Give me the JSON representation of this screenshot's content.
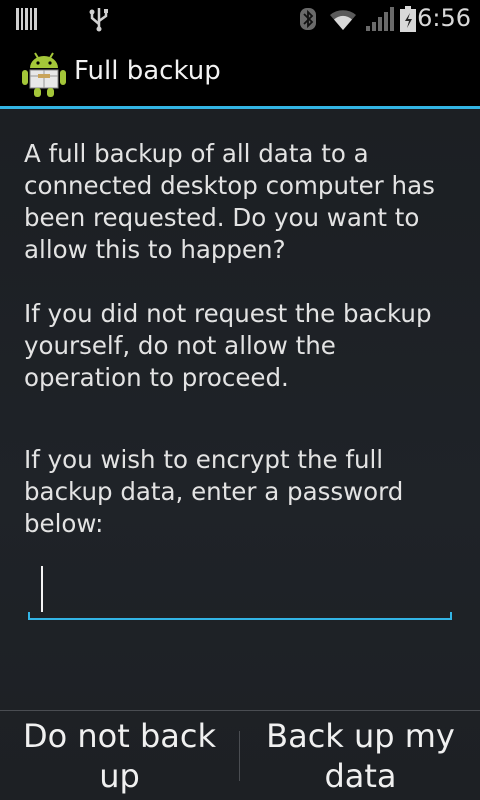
{
  "status_bar": {
    "time": "6:56",
    "icons": [
      "barcode-notification-icon",
      "usb-icon",
      "bluetooth-icon",
      "wifi-icon",
      "signal-icon",
      "battery-icon"
    ]
  },
  "title_bar": {
    "icon": "android-robot-icon",
    "title": "Full backup"
  },
  "message": {
    "paragraph1": "A full backup of all data to a connected desktop computer has been requested. Do you want to allow this to happen?",
    "paragraph2": "If you did not request the backup yourself, do not allow the operation to proceed.",
    "paragraph3": "If you wish to encrypt the full backup data, enter a password below:"
  },
  "password_field": {
    "value": "",
    "placeholder": ""
  },
  "buttons": {
    "deny": "Do not back up",
    "allow": "Back up my data"
  },
  "colors": {
    "accent": "#33b5e5",
    "background": "#1f2328",
    "android_green": "#a4c639"
  }
}
